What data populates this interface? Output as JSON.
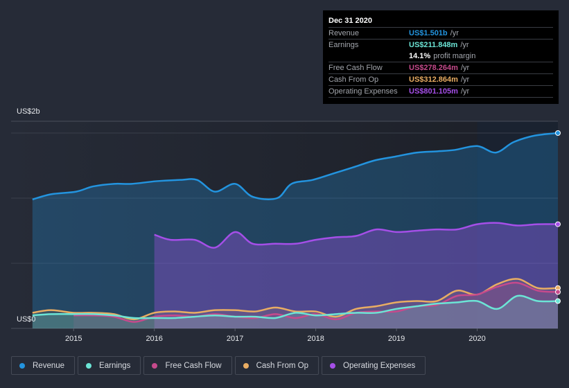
{
  "tooltip": {
    "date": "Dec 31 2020",
    "rows": [
      {
        "label": "Revenue",
        "value": "US$1.501b",
        "unit": "/yr",
        "color": "#2394df"
      },
      {
        "label": "Earnings",
        "value": "US$211.848m",
        "unit": "/yr",
        "color": "#6ce5d6"
      },
      {
        "label": "",
        "value": "14.1%",
        "unit": "profit margin",
        "color": "#ffffff"
      },
      {
        "label": "Free Cash Flow",
        "value": "US$278.264m",
        "unit": "/yr",
        "color": "#c64a8c"
      },
      {
        "label": "Cash From Op",
        "value": "US$312.864m",
        "unit": "/yr",
        "color": "#e9ad63"
      },
      {
        "label": "Operating Expenses",
        "value": "US$801.105m",
        "unit": "/yr",
        "color": "#a54fe8"
      }
    ]
  },
  "legend": [
    {
      "label": "Revenue",
      "color": "#2394df"
    },
    {
      "label": "Earnings",
      "color": "#6ce5d6"
    },
    {
      "label": "Free Cash Flow",
      "color": "#c64a8c"
    },
    {
      "label": "Cash From Op",
      "color": "#e9ad63"
    },
    {
      "label": "Operating Expenses",
      "color": "#a54fe8"
    }
  ],
  "chart_data": {
    "type": "area",
    "title": "",
    "xlabel": "",
    "ylabel": "",
    "y_unit": "US$ billions",
    "ytick_labels": [
      "US$2b",
      "US$0"
    ],
    "ylim": [
      0,
      2
    ],
    "xlim": [
      2014.5,
      2021.0
    ],
    "x_ticks": [
      2015,
      2016,
      2017,
      2018,
      2019,
      2020
    ],
    "x_tick_labels": [
      "2015",
      "2016",
      "2017",
      "2018",
      "2019",
      "2020"
    ],
    "highlight_range": [
      2020.0,
      2021.0
    ],
    "grid": true,
    "legend_position": "bottom",
    "series": [
      {
        "name": "Revenue",
        "color": "#2394df",
        "x": [
          2014.49,
          2014.72,
          2015.03,
          2015.24,
          2015.5,
          2015.72,
          2016.02,
          2016.32,
          2016.53,
          2016.75,
          2017.0,
          2017.22,
          2017.52,
          2017.7,
          2017.96,
          2018.22,
          2018.48,
          2018.73,
          2018.99,
          2019.25,
          2019.51,
          2019.72,
          2020.0,
          2020.23,
          2020.45,
          2020.71,
          2021.0
        ],
        "values": [
          0.99,
          1.03,
          1.05,
          1.09,
          1.11,
          1.11,
          1.13,
          1.14,
          1.14,
          1.05,
          1.11,
          1.01,
          1.0,
          1.11,
          1.14,
          1.19,
          1.24,
          1.29,
          1.32,
          1.35,
          1.36,
          1.37,
          1.4,
          1.35,
          1.43,
          1.48,
          1.5
        ]
      },
      {
        "name": "Operating Expenses",
        "color": "#a54fe8",
        "x": [
          2016.0,
          2016.2,
          2016.5,
          2016.75,
          2017.0,
          2017.22,
          2017.5,
          2017.75,
          2018.0,
          2018.25,
          2018.5,
          2018.75,
          2019.0,
          2019.25,
          2019.5,
          2019.75,
          2020.0,
          2020.25,
          2020.5,
          2020.75,
          2021.0
        ],
        "values": [
          0.72,
          0.68,
          0.68,
          0.62,
          0.74,
          0.65,
          0.65,
          0.65,
          0.68,
          0.7,
          0.71,
          0.76,
          0.74,
          0.75,
          0.76,
          0.76,
          0.8,
          0.81,
          0.79,
          0.8,
          0.8
        ]
      },
      {
        "name": "Cash From Op",
        "color": "#e9ad63",
        "x": [
          2014.49,
          2014.72,
          2015.0,
          2015.25,
          2015.5,
          2015.75,
          2016.0,
          2016.25,
          2016.5,
          2016.75,
          2017.0,
          2017.25,
          2017.5,
          2017.75,
          2018.0,
          2018.25,
          2018.5,
          2018.75,
          2019.0,
          2019.25,
          2019.5,
          2019.75,
          2020.0,
          2020.25,
          2020.5,
          2020.75,
          2021.0
        ],
        "values": [
          0.12,
          0.14,
          0.12,
          0.12,
          0.11,
          0.07,
          0.12,
          0.13,
          0.12,
          0.14,
          0.14,
          0.13,
          0.16,
          0.13,
          0.13,
          0.09,
          0.15,
          0.17,
          0.2,
          0.21,
          0.21,
          0.29,
          0.26,
          0.34,
          0.38,
          0.31,
          0.31
        ]
      },
      {
        "name": "Free Cash Flow",
        "color": "#c64a8c",
        "x": [
          2015.0,
          2015.25,
          2015.5,
          2015.75,
          2016.0,
          2016.25,
          2016.5,
          2016.75,
          2017.0,
          2017.25,
          2017.5,
          2017.75,
          2018.0,
          2018.25,
          2018.5,
          2018.75,
          2019.0,
          2019.25,
          2019.5,
          2019.75,
          2020.0,
          2020.25,
          2020.5,
          2020.75,
          2021.0
        ],
        "values": [
          0.1,
          0.1,
          0.09,
          0.05,
          0.09,
          0.1,
          0.09,
          0.11,
          0.09,
          0.08,
          0.11,
          0.08,
          0.11,
          0.07,
          0.12,
          0.13,
          0.13,
          0.17,
          0.18,
          0.25,
          0.26,
          0.32,
          0.35,
          0.29,
          0.28
        ]
      },
      {
        "name": "Earnings",
        "color": "#6ce5d6",
        "x": [
          2014.49,
          2014.72,
          2015.0,
          2015.25,
          2015.5,
          2015.75,
          2016.0,
          2016.25,
          2016.5,
          2016.75,
          2017.0,
          2017.25,
          2017.5,
          2017.75,
          2018.0,
          2018.25,
          2018.5,
          2018.75,
          2019.0,
          2019.25,
          2019.5,
          2019.75,
          2020.0,
          2020.25,
          2020.5,
          2020.75,
          2021.0
        ],
        "values": [
          0.1,
          0.11,
          0.11,
          0.11,
          0.1,
          0.08,
          0.08,
          0.08,
          0.09,
          0.1,
          0.09,
          0.09,
          0.08,
          0.12,
          0.1,
          0.11,
          0.12,
          0.12,
          0.15,
          0.17,
          0.19,
          0.2,
          0.21,
          0.15,
          0.25,
          0.21,
          0.21
        ]
      }
    ]
  }
}
